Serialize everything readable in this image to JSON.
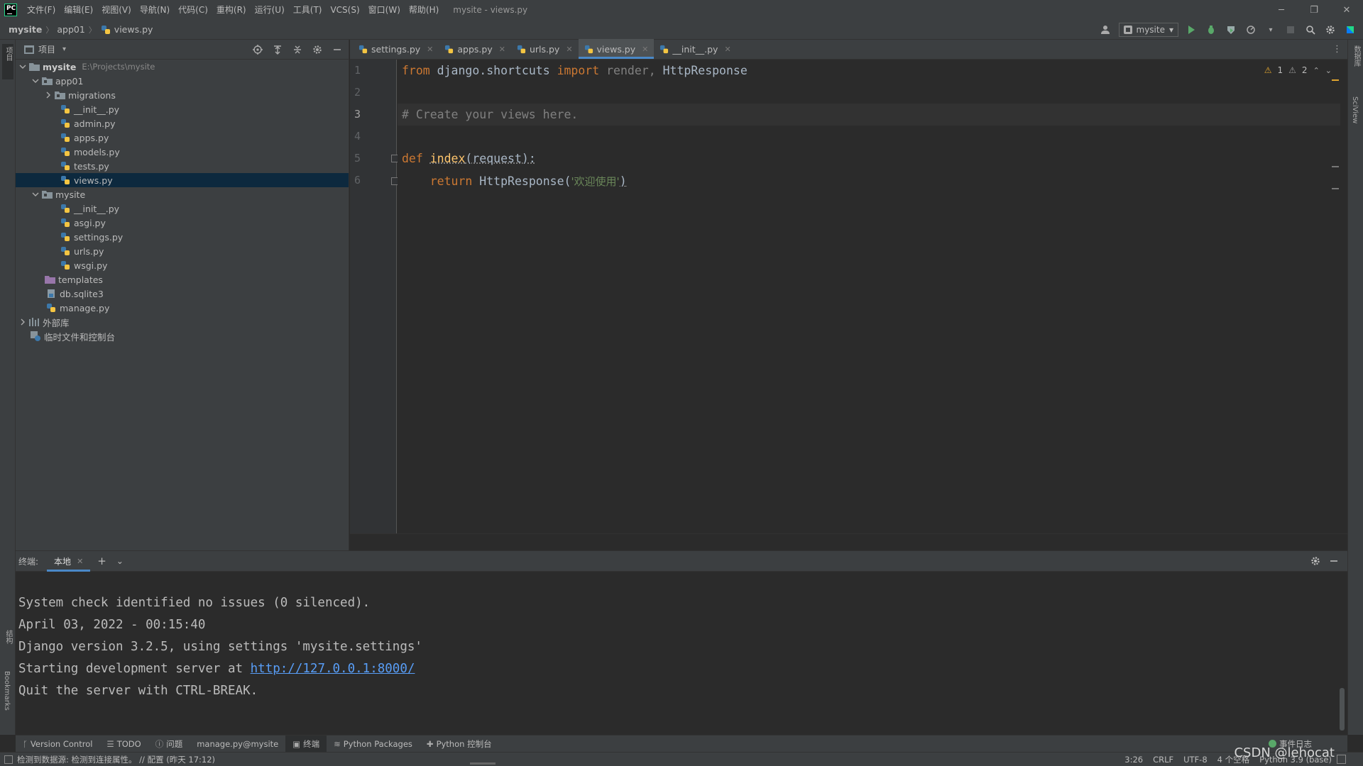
{
  "titlebar": {
    "logo": "PC",
    "menu": [
      "文件(F)",
      "编辑(E)",
      "视图(V)",
      "导航(N)",
      "代码(C)",
      "重构(R)",
      "运行(U)",
      "工具(T)",
      "VCS(S)",
      "窗口(W)",
      "帮助(H)"
    ],
    "window_title": "mysite - views.py",
    "minimize": "─",
    "restore": "❐",
    "close": "✕"
  },
  "navbar": {
    "crumbs": [
      "mysite",
      "app01",
      "views.py"
    ],
    "run_config": "mysite"
  },
  "left_strip": {
    "project_label": "项目",
    "structure_label": "结构",
    "bookmarks_label": "Bookmarks"
  },
  "right_strip": {
    "database_label": "数据库",
    "sciview_label": "SciView"
  },
  "project": {
    "title": "项目",
    "tree": [
      {
        "label": "mysite",
        "hint": "E:\\Projects\\mysite"
      },
      {
        "label": "app01"
      },
      {
        "label": "migrations"
      },
      {
        "label": "__init__.py"
      },
      {
        "label": "admin.py"
      },
      {
        "label": "apps.py"
      },
      {
        "label": "models.py"
      },
      {
        "label": "tests.py"
      },
      {
        "label": "views.py"
      },
      {
        "label": "mysite"
      },
      {
        "label": "__init__.py"
      },
      {
        "label": "asgi.py"
      },
      {
        "label": "settings.py"
      },
      {
        "label": "urls.py"
      },
      {
        "label": "wsgi.py"
      },
      {
        "label": "templates"
      },
      {
        "label": "db.sqlite3"
      },
      {
        "label": "manage.py"
      },
      {
        "label": "外部库"
      },
      {
        "label": "临时文件和控制台"
      }
    ]
  },
  "editor": {
    "tabs": [
      "settings.py",
      "apps.py",
      "urls.py",
      "views.py",
      "__init__.py"
    ],
    "active_tab": "views.py",
    "line_numbers": [
      "1",
      "2",
      "3",
      "4",
      "5",
      "6"
    ],
    "warnings": "1",
    "weak_warnings": "2",
    "code": {
      "l1_from": "from",
      "l1_module": " django.shortcuts ",
      "l1_import": "import",
      "l1_render": " render,",
      "l1_http": " HttpResponse",
      "l3_comment": "# Create your views here.",
      "l5_def": "def",
      "l5_name": "index",
      "l5_rest": "(request):",
      "l6_indent": "    ",
      "l6_return": "return",
      "l6_call": " HttpResponse(",
      "l6_str": "'欢迎使用'",
      "l6_close": ")"
    }
  },
  "terminal": {
    "label": "终端:",
    "tab": "本地",
    "lines": [
      "System check identified no issues (0 silenced).",
      "April 03, 2022 - 00:15:40",
      "Django version 3.2.5, using settings 'mysite.settings'",
      "Starting development server at ",
      "Quit the server with CTRL-BREAK."
    ],
    "url": "http://127.0.0.1:8000/"
  },
  "toolwindows": [
    "Version Control",
    "TODO",
    "问题",
    "manage.py@mysite",
    "终端",
    "Python Packages",
    "Python 控制台"
  ],
  "event_log": "事件日志",
  "status": {
    "message": "检测到数据源: 检测到连接属性。 // 配置 (昨天 17:12)",
    "position": "3:26",
    "line_sep": "CRLF",
    "encoding": "UTF-8",
    "indent": "4 个空格",
    "interpreter": "Python 3.9 (base)"
  },
  "watermark": "CSDN @lehocat",
  "colors": {
    "accent": "#4a88c7",
    "keyword": "#cc7832",
    "function": "#ffc66d",
    "string": "#6a8759",
    "comment": "#808080",
    "link": "#589df6"
  }
}
